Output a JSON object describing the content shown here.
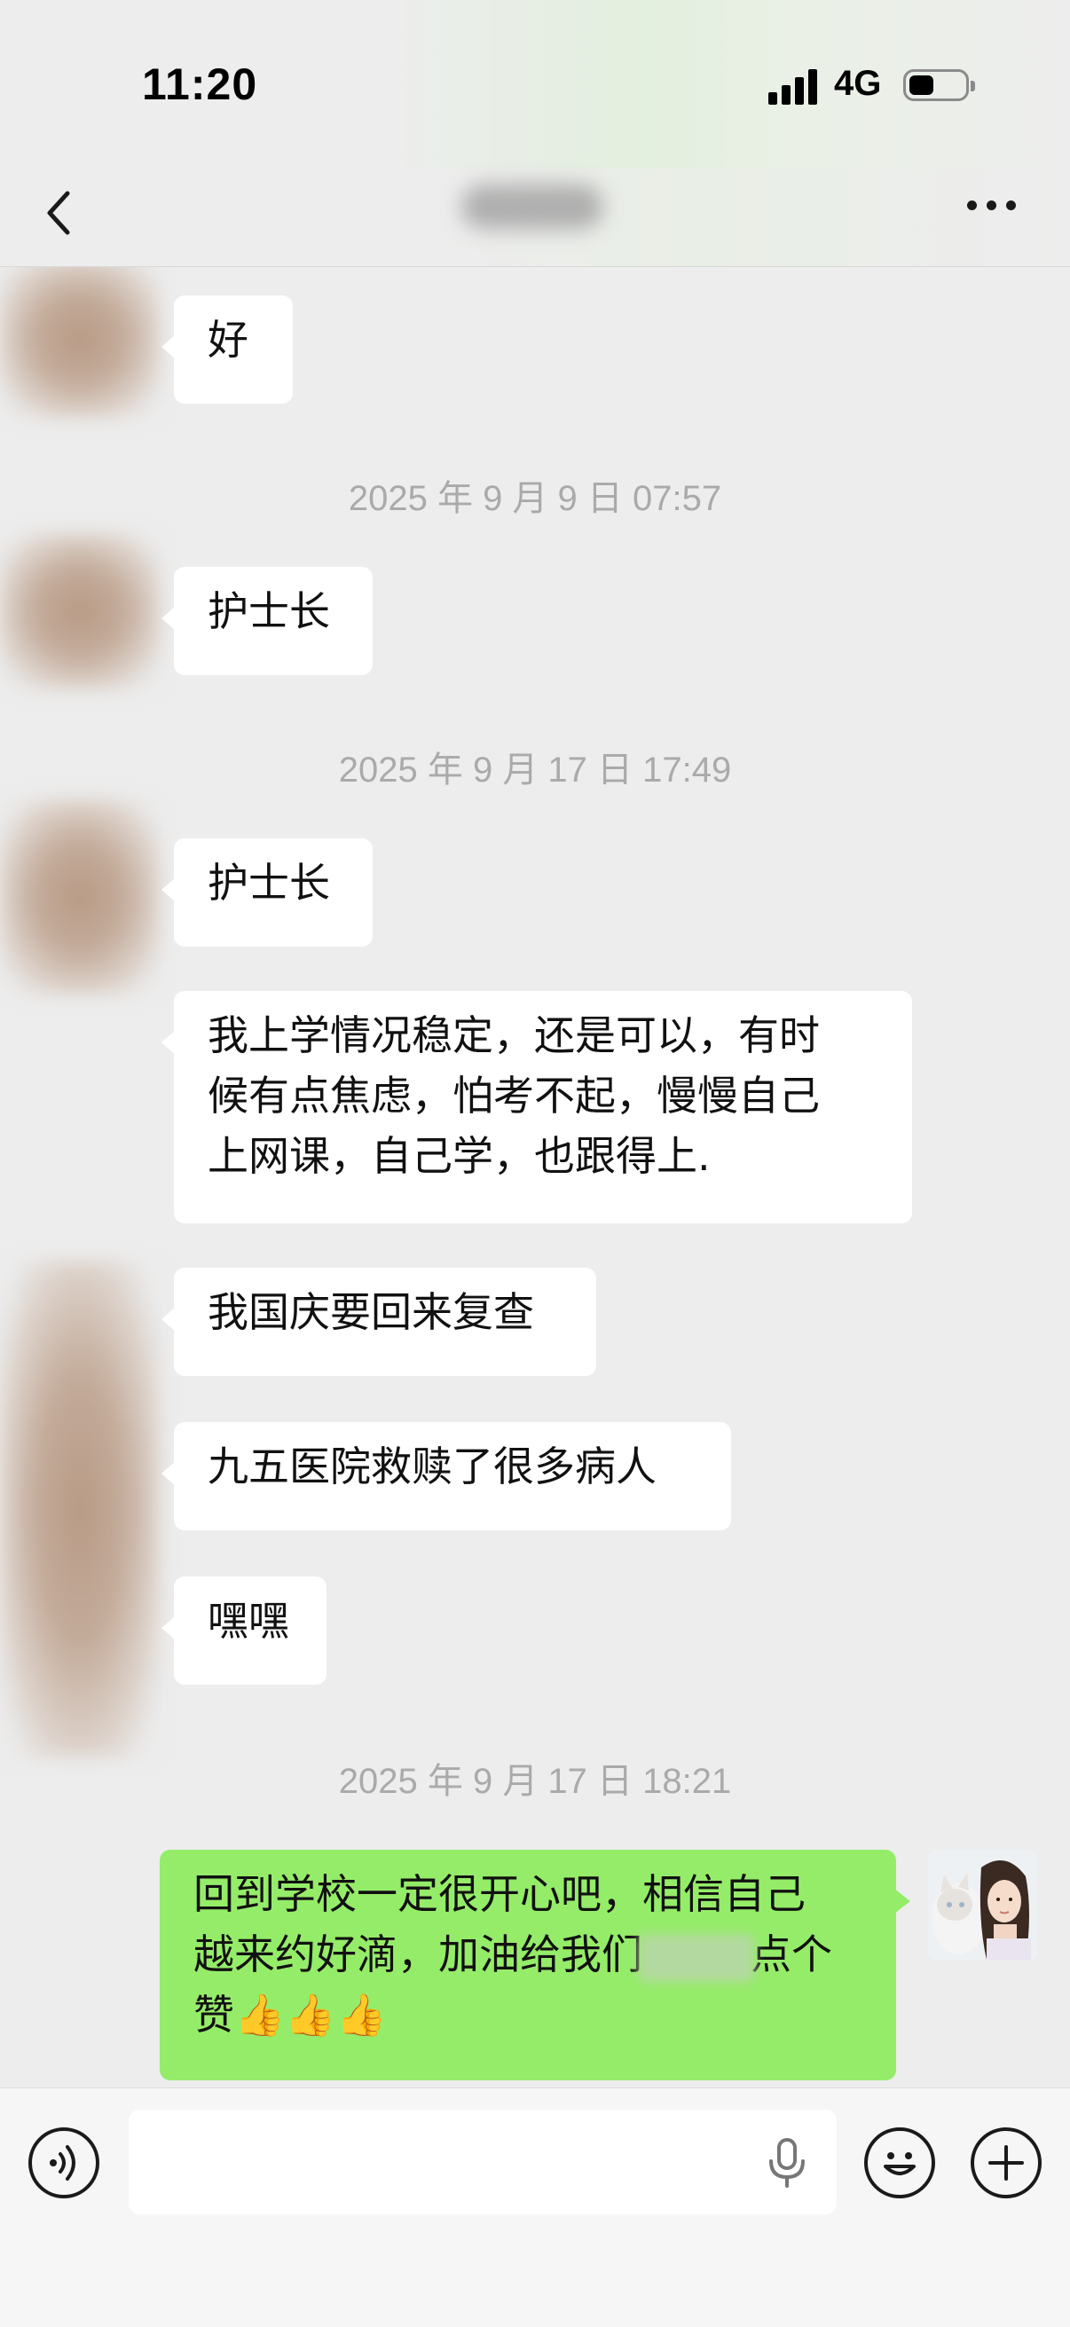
{
  "status_bar": {
    "time": "11:20",
    "network": "4G",
    "battery_level": 0.45
  },
  "nav": {
    "back_icon": "chevron-left-icon",
    "more_icon": "more-dots-icon"
  },
  "messages": {
    "m1": "好",
    "ts1": "2025 年 9 月 9 日 07:57",
    "m2": "护士长",
    "ts2": "2025 年 9 月 17 日 17:49",
    "m3": "护士长",
    "m4_line1": "我上学情况稳定，还是可以，有时",
    "m4_line2": "候有点焦虑，怕考不起，慢慢自己",
    "m4_line3": "上网课，自己学，也跟得上.",
    "m5": "我国庆要回来复查",
    "m6": "九五医院救赎了很多病人",
    "m7": "嘿嘿",
    "ts3": "2025 年 9 月 17 日 18:21",
    "out_line1": "回到学校一定很开心吧，相信自己",
    "out_line2_a": "越来约好滴，加油给我们",
    "out_line2_b": "点个",
    "out_line3": "赞👍👍👍"
  },
  "input_bar": {
    "voice_icon": "voice-mode-icon",
    "mic_icon": "microphone-icon",
    "emoji_icon": "emoji-icon",
    "plus_icon": "plus-icon",
    "input_value": ""
  },
  "colors": {
    "incoming_bubble": "#ffffff",
    "outgoing_bubble": "#95ec69",
    "background": "#ededed",
    "timestamp": "#aaaaaa"
  }
}
